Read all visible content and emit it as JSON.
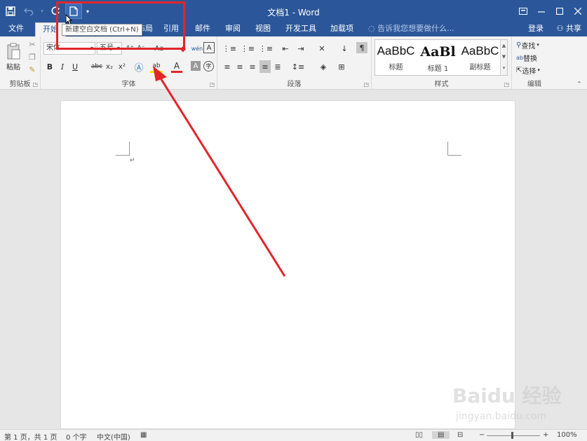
{
  "app": {
    "window_title": "文档1 - Word"
  },
  "quick_access": {
    "save_icon": "save-icon",
    "undo_icon": "undo-icon",
    "redo_icon": "redo-icon",
    "new_doc_icon": "new-document-icon",
    "customize_icon": "customize-qat-icon",
    "tooltip": "新建空白文档 (Ctrl+N)"
  },
  "tabs": [
    {
      "label": "文件"
    },
    {
      "label": "开始"
    },
    {
      "label": "布局"
    },
    {
      "label": "引用"
    },
    {
      "label": "邮件"
    },
    {
      "label": "审阅"
    },
    {
      "label": "视图"
    },
    {
      "label": "开发工具"
    },
    {
      "label": "加载项"
    }
  ],
  "tell_me": "告诉我您想要做什么...",
  "account": {
    "signin": "登录",
    "share": "共享"
  },
  "ribbon": {
    "clipboard": {
      "label": "剪贴板",
      "paste": "粘贴"
    },
    "font": {
      "label": "字体",
      "font_name": "宋体",
      "font_size": "五号",
      "bold": "B",
      "italic": "I",
      "underline": "U",
      "strike": "abc",
      "subscript": "x₂",
      "superscript": "x²",
      "grow": "A⁺",
      "shrink": "A⁻",
      "change_case": "Aa",
      "font_color": "A",
      "highlight": "ab",
      "char_shading": "A"
    },
    "paragraph": {
      "label": "段落"
    },
    "styles": {
      "label": "样式",
      "items": [
        {
          "sample": "AaBbC",
          "name": "标题"
        },
        {
          "sample": "AaBl",
          "name": "标题 1"
        },
        {
          "sample": "AaBbC",
          "name": "副标题"
        }
      ]
    },
    "editing": {
      "label": "编辑",
      "find": "查找",
      "replace": "替换",
      "select": "选择"
    }
  },
  "status": {
    "page": "第 1 页，共 1 页",
    "words": "0 个字",
    "language": "中文(中国)",
    "zoom": "100%"
  },
  "watermark": {
    "main": "Baidu 经验",
    "sub": "jingyan.baidu.com"
  },
  "colors": {
    "word_blue": "#2b579a",
    "annotation_red": "#e0262b"
  }
}
